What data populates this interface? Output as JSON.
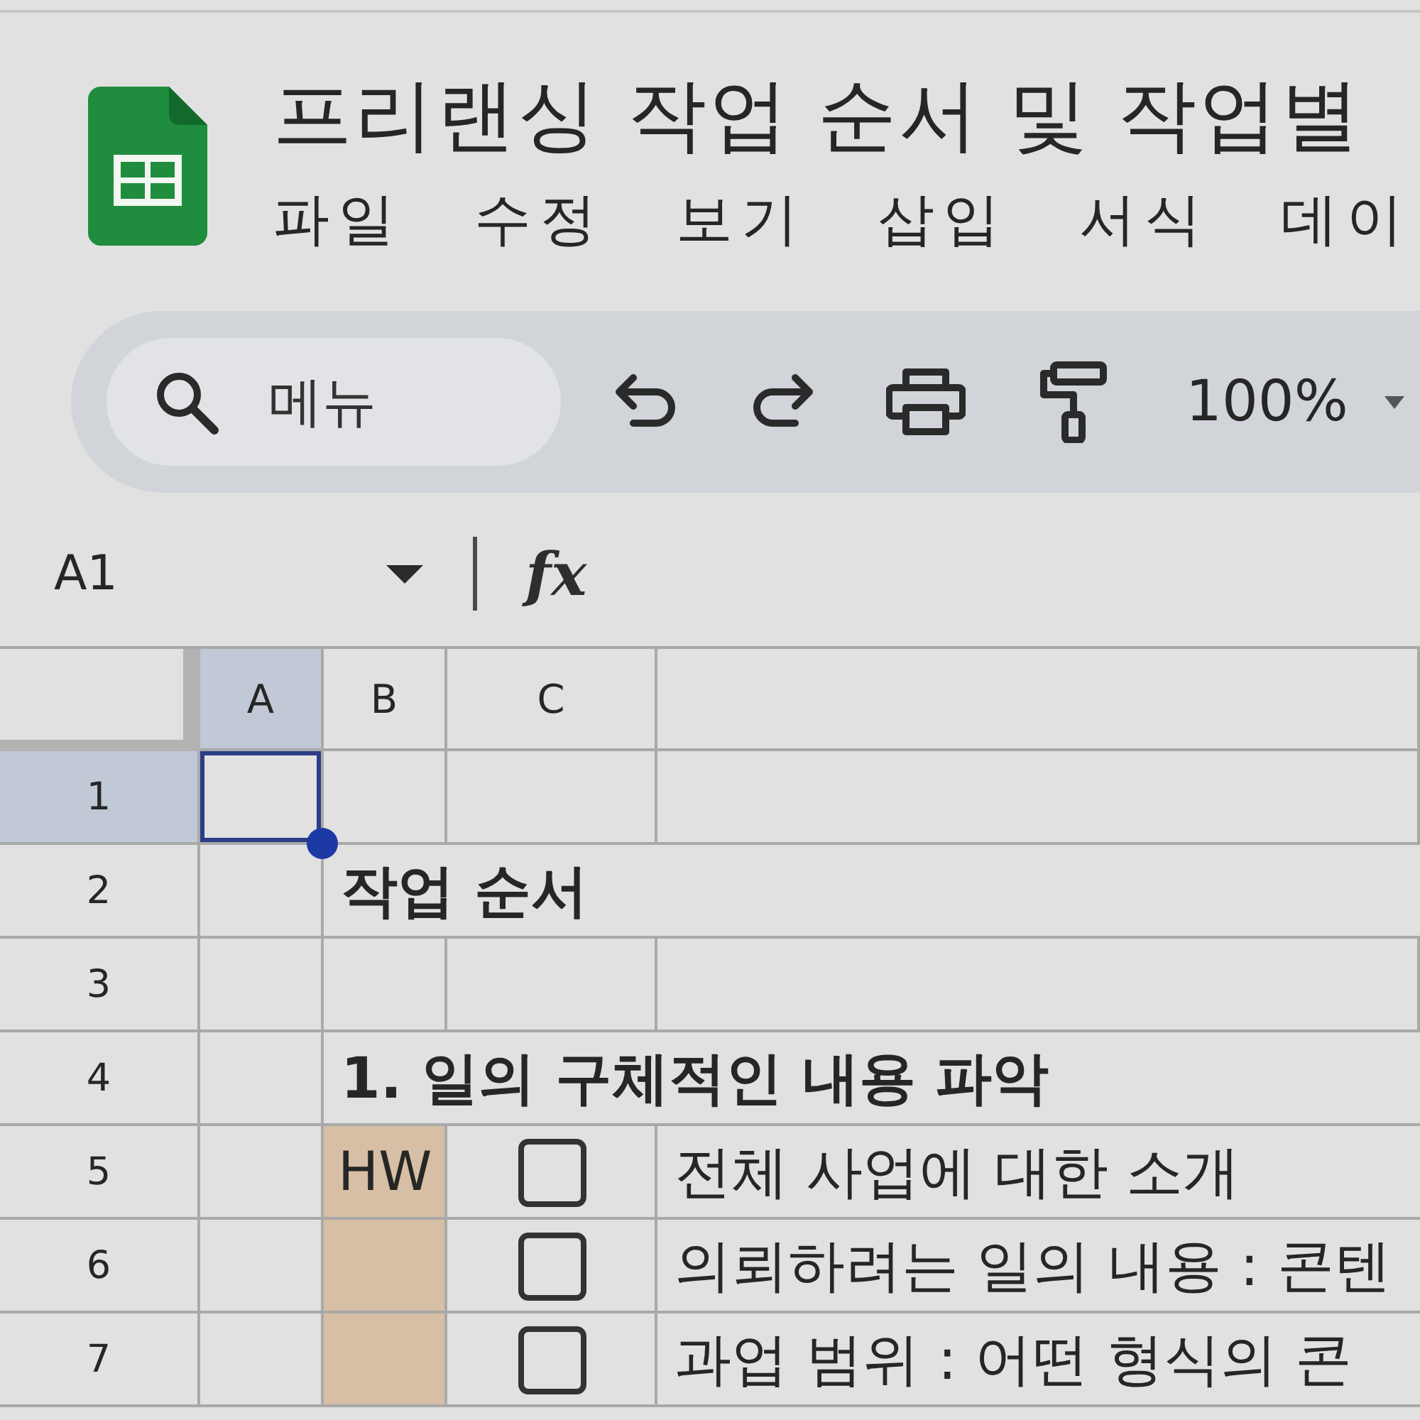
{
  "app": {
    "title": "프리랜싱 작업 순서 및 작업별"
  },
  "menu": [
    "파일",
    "수정",
    "보기",
    "삽입",
    "서식",
    "데이"
  ],
  "toolbar": {
    "search": {
      "placeholder": "메뉴"
    },
    "zoom": "100%"
  },
  "formula_bar": {
    "cell_reference": "A1",
    "function_label": "fx"
  },
  "sheet": {
    "columns": [
      {
        "label": "A",
        "selected": true
      },
      {
        "label": "B",
        "selected": false
      },
      {
        "label": "C",
        "selected": false
      }
    ],
    "rows": [
      {
        "number": "1",
        "selected": true,
        "kind": "blank"
      },
      {
        "number": "2",
        "selected": false,
        "kind": "heading",
        "text": "작업 순서"
      },
      {
        "number": "3",
        "selected": false,
        "kind": "blank"
      },
      {
        "number": "4",
        "selected": false,
        "kind": "heading",
        "text": "1. 일의 구체적인 내용 파악"
      },
      {
        "number": "5",
        "selected": false,
        "kind": "task",
        "tag": "HW",
        "color": "#d6bfa5",
        "checked": false,
        "text": "전체 사업에 대한 소개"
      },
      {
        "number": "6",
        "selected": false,
        "kind": "task",
        "color": "#d6bfa5",
        "checked": false,
        "text": "의뢰하려는 일의 내용 : 콘텐"
      },
      {
        "number": "7",
        "selected": false,
        "kind": "task",
        "color": "#d6bfa5",
        "checked": false,
        "text": "과업 범위 : 어떤 형식의 콘"
      }
    ]
  }
}
